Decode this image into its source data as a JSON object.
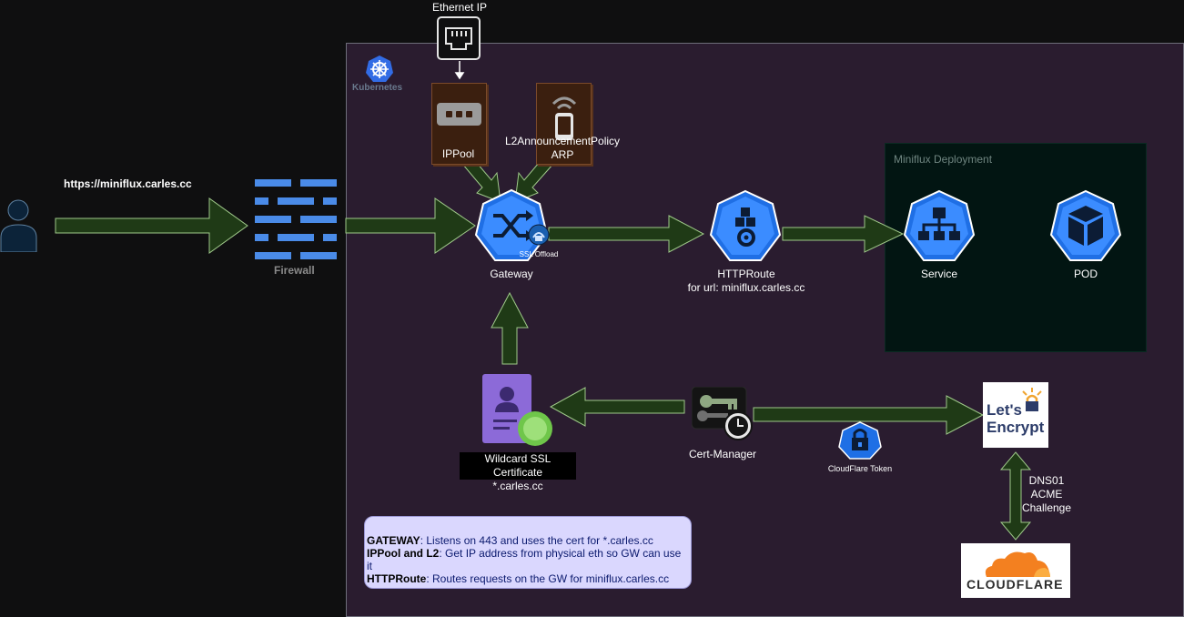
{
  "top": {
    "ethernet_label": "Ethernet IP"
  },
  "user": {
    "url_label": "https://miniflux.carles.cc"
  },
  "firewall": {
    "label": "Firewall"
  },
  "kubernetes": {
    "label": "Kubernetes"
  },
  "ippool": {
    "label": "IPPool"
  },
  "l2": {
    "line1": "L2AnnouncementPolicy",
    "line2": "ARP"
  },
  "gateway": {
    "label": "Gateway",
    "badge": "SSL Offload"
  },
  "httproute": {
    "line1": "HTTPRoute",
    "line2": "for url: miniflux.carles.cc"
  },
  "deployment": {
    "title": "Miniflux Deployment"
  },
  "service": {
    "label": "Service"
  },
  "pod": {
    "label": "POD"
  },
  "certificate": {
    "line1": "Wildcard SSL Certificate",
    "line2": "*.carles.cc"
  },
  "cert_manager": {
    "label": "Cert-Manager"
  },
  "cloudflare_token": {
    "label": "CloudFlare Token"
  },
  "letsencrypt": {
    "line1": "Let's",
    "line2": "Encrypt"
  },
  "dns01": {
    "line1": "DNS01",
    "line2": "ACME",
    "line3": "Challenge"
  },
  "cloudflare": {
    "wordmark": "CLOUDFLARE"
  },
  "note": {
    "l1_key": "GATEWAY",
    "l1_text": ": Listens on 443 and uses the cert for *.carles.cc",
    "l2_key": "IPPool and L2",
    "l2_text": ": Get IP address from physical eth so GW can use it",
    "l3_key": "HTTPRoute",
    "l3_text": ": Routes requests on the GW for miniflux.carles.cc"
  },
  "colors": {
    "arrow_fill": "#1f3a16",
    "arrow_stroke": "#9fc98a",
    "k8s_blue": "#2f80ed",
    "firewall_blue": "#4a8be8",
    "region_bg": "#2a1c2f",
    "deployment_bg": "#021512",
    "cloudflare_orange": "#f38020"
  }
}
